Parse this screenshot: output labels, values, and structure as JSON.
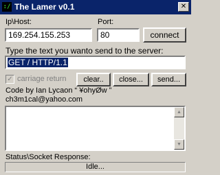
{
  "window": {
    "title": "The Lamer v0.1",
    "close_glyph": "✕"
  },
  "form": {
    "host_label": "Ip\\Host:",
    "host_value": "169.254.155.253",
    "port_label": "Port:",
    "port_value": "80",
    "connect_label": "connect",
    "send_prompt": "Type the text you wanto send to the server:",
    "send_text": "GET / HTTP/1.1",
    "carriage_return_label": "carriage return",
    "carriage_return_checked": true,
    "clear_label": "clear..",
    "close_label": "close...",
    "send_label": "send..."
  },
  "credits": {
    "line1": "Code by Ian Lycaon “ ¥ohyØw ”",
    "line2": "ch3m1cal@yahoo.com"
  },
  "response": {
    "label": "Status\\Socket Response:",
    "status": "Idle..."
  },
  "icons": [
    "app-icon",
    "close-icon",
    "check-icon",
    "scroll-up-icon",
    "scroll-down-icon"
  ]
}
